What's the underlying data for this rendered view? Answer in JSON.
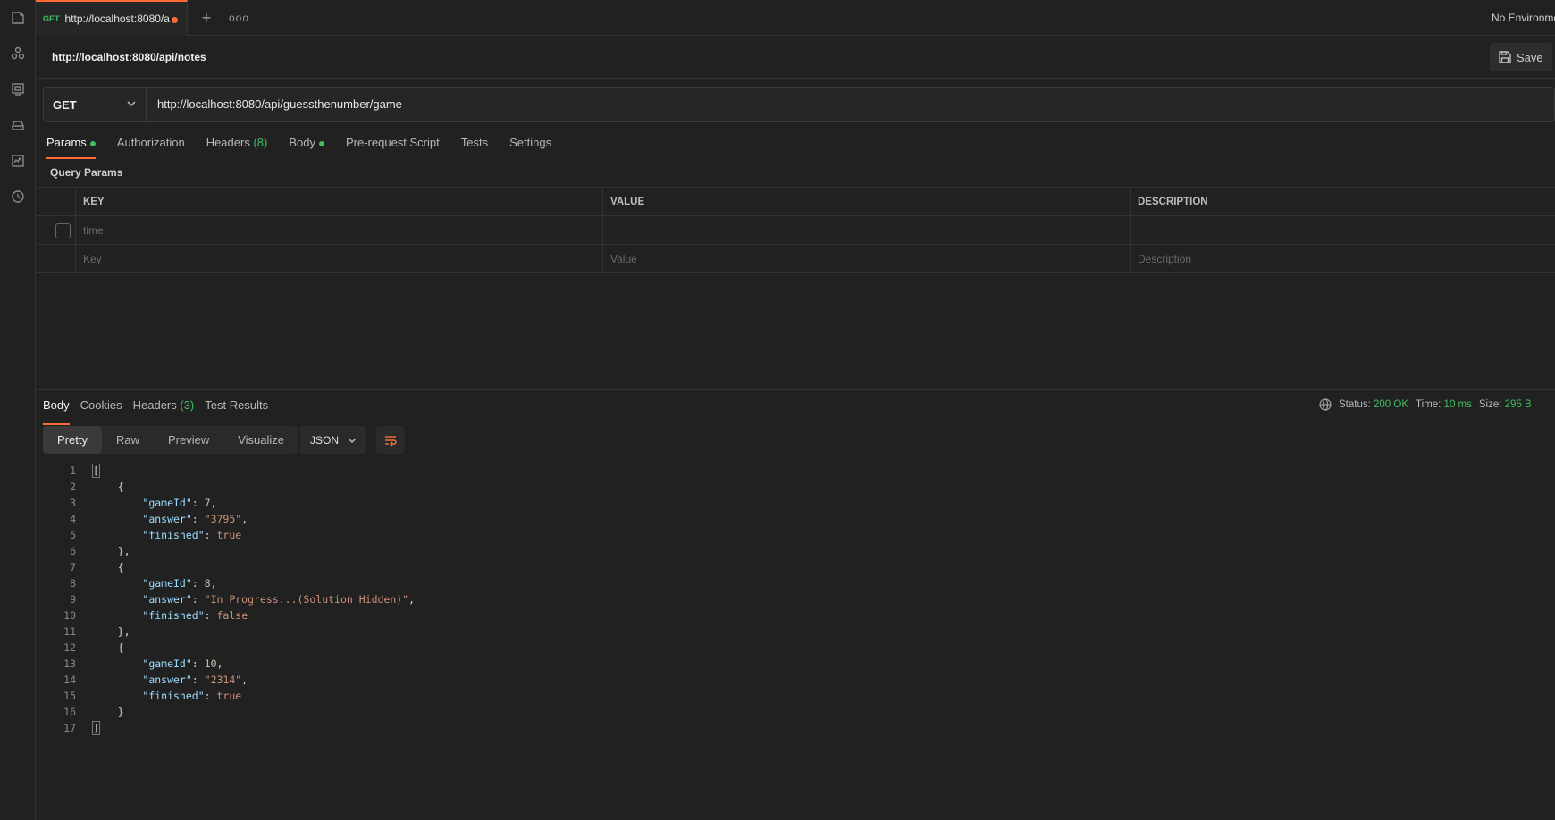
{
  "sidebar": {
    "icons": [
      "collections-icon",
      "apis-icon",
      "environments-icon",
      "mock-servers-icon",
      "monitors-icon",
      "history-icon"
    ]
  },
  "tabs": {
    "active": {
      "method": "GET",
      "title": "http://localhost:8080/a"
    },
    "add_label": "+",
    "more_label": "ooo",
    "environment": "No Environme"
  },
  "request": {
    "name": "http://localhost:8080/api/notes",
    "save_label": "Save",
    "method": "GET",
    "url": "http://localhost:8080/api/guessthenumber/game"
  },
  "request_tabs": [
    {
      "label": "Params",
      "dot": true
    },
    {
      "label": "Authorization"
    },
    {
      "label": "Headers",
      "count": "(8)"
    },
    {
      "label": "Body",
      "dot": true
    },
    {
      "label": "Pre-request Script"
    },
    {
      "label": "Tests"
    },
    {
      "label": "Settings"
    }
  ],
  "query_params": {
    "title": "Query Params",
    "headers": {
      "key": "KEY",
      "value": "VALUE",
      "description": "DESCRIPTION"
    },
    "rows": [
      {
        "key_placeholder": "time"
      }
    ],
    "new_row": {
      "key": "Key",
      "value": "Value",
      "description": "Description"
    }
  },
  "response": {
    "tabs": [
      {
        "label": "Body"
      },
      {
        "label": "Cookies"
      },
      {
        "label": "Headers",
        "count": "(3)"
      },
      {
        "label": "Test Results"
      }
    ],
    "status_label": "Status:",
    "status_value": "200 OK",
    "time_label": "Time:",
    "time_value": "10 ms",
    "size_label": "Size:",
    "size_value": "295 B",
    "views": [
      "Pretty",
      "Raw",
      "Preview",
      "Visualize"
    ],
    "format": "JSON",
    "body_lines": [
      {
        "n": "1",
        "parts": [
          [
            "b",
            "["
          ]
        ]
      },
      {
        "n": "2",
        "parts": [
          [
            "p",
            "    {"
          ]
        ]
      },
      {
        "n": "3",
        "parts": [
          [
            "p",
            "        "
          ],
          [
            "k",
            "\"gameId\""
          ],
          [
            "p",
            ": "
          ],
          [
            "n",
            "7"
          ],
          [
            "p",
            ","
          ]
        ]
      },
      {
        "n": "4",
        "parts": [
          [
            "p",
            "        "
          ],
          [
            "k",
            "\"answer\""
          ],
          [
            "p",
            ": "
          ],
          [
            "s",
            "\"3795\""
          ],
          [
            "p",
            ","
          ]
        ]
      },
      {
        "n": "5",
        "parts": [
          [
            "p",
            "        "
          ],
          [
            "k",
            "\"finished\""
          ],
          [
            "p",
            ": "
          ],
          [
            "s",
            "true"
          ]
        ]
      },
      {
        "n": "6",
        "parts": [
          [
            "p",
            "    },"
          ]
        ]
      },
      {
        "n": "7",
        "parts": [
          [
            "p",
            "    {"
          ]
        ]
      },
      {
        "n": "8",
        "parts": [
          [
            "p",
            "        "
          ],
          [
            "k",
            "\"gameId\""
          ],
          [
            "p",
            ": "
          ],
          [
            "n",
            "8"
          ],
          [
            "p",
            ","
          ]
        ]
      },
      {
        "n": "9",
        "parts": [
          [
            "p",
            "        "
          ],
          [
            "k",
            "\"answer\""
          ],
          [
            "p",
            ": "
          ],
          [
            "s",
            "\"In Progress...(Solution Hidden)\""
          ],
          [
            "p",
            ","
          ]
        ]
      },
      {
        "n": "10",
        "parts": [
          [
            "p",
            "        "
          ],
          [
            "k",
            "\"finished\""
          ],
          [
            "p",
            ": "
          ],
          [
            "s",
            "false"
          ]
        ]
      },
      {
        "n": "11",
        "parts": [
          [
            "p",
            "    },"
          ]
        ]
      },
      {
        "n": "12",
        "parts": [
          [
            "p",
            "    {"
          ]
        ]
      },
      {
        "n": "13",
        "parts": [
          [
            "p",
            "        "
          ],
          [
            "k",
            "\"gameId\""
          ],
          [
            "p",
            ": "
          ],
          [
            "n",
            "10"
          ],
          [
            "p",
            ","
          ]
        ]
      },
      {
        "n": "14",
        "parts": [
          [
            "p",
            "        "
          ],
          [
            "k",
            "\"answer\""
          ],
          [
            "p",
            ": "
          ],
          [
            "s",
            "\"2314\""
          ],
          [
            "p",
            ","
          ]
        ]
      },
      {
        "n": "15",
        "parts": [
          [
            "p",
            "        "
          ],
          [
            "k",
            "\"finished\""
          ],
          [
            "p",
            ": "
          ],
          [
            "s",
            "true"
          ]
        ]
      },
      {
        "n": "16",
        "parts": [
          [
            "p",
            "    }"
          ]
        ]
      },
      {
        "n": "17",
        "parts": [
          [
            "b",
            "]"
          ]
        ]
      }
    ]
  },
  "colors": {
    "accent": "#ff6c37",
    "success": "#3fbf5f",
    "background": "#212121"
  }
}
